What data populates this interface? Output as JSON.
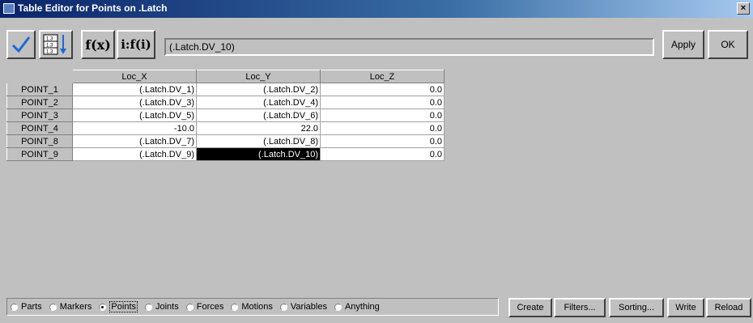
{
  "window": {
    "title": "Table Editor for Points on .Latch",
    "close": "×"
  },
  "toolbar": {
    "fx_label": "f(x)",
    "ifi_label": "i:f(i)",
    "expression_value": "(.Latch.DV_10)",
    "apply_label": "Apply",
    "ok_label": "OK"
  },
  "table": {
    "columns": [
      "Loc_X",
      "Loc_Y",
      "Loc_Z"
    ],
    "rows": [
      {
        "name": "POINT_1",
        "cells": [
          "(.Latch.DV_1)",
          "(.Latch.DV_2)",
          "0.0"
        ]
      },
      {
        "name": "POINT_2",
        "cells": [
          "(.Latch.DV_3)",
          "(.Latch.DV_4)",
          "0.0"
        ]
      },
      {
        "name": "POINT_3",
        "cells": [
          "(.Latch.DV_5)",
          "(.Latch.DV_6)",
          "0.0"
        ]
      },
      {
        "name": "POINT_4",
        "cells": [
          "-10.0",
          "22.0",
          "0.0"
        ]
      },
      {
        "name": "POINT_8",
        "cells": [
          "(.Latch.DV_7)",
          "(.Latch.DV_8)",
          "0.0"
        ]
      },
      {
        "name": "POINT_9",
        "cells": [
          "(.Latch.DV_9)",
          "(.Latch.DV_10)",
          "0.0"
        ]
      }
    ]
  },
  "filter": {
    "options": [
      "Parts",
      "Markers",
      "Points",
      "Joints",
      "Forces",
      "Motions",
      "Variables",
      "Anything"
    ],
    "selected": "Points"
  },
  "actions": {
    "create_label": "Create",
    "filters_label": "Filters...",
    "sorting_label": "Sorting...",
    "write_label": "Write",
    "reload_label": "Reload"
  }
}
